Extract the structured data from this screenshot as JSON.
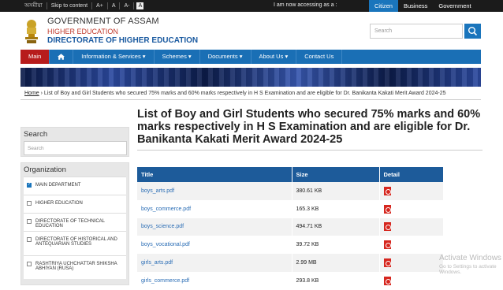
{
  "topbar": {
    "lang": "অসমীয়া",
    "skip": "Skip to content",
    "font_plus": "A+",
    "font_normal": "A",
    "font_minus": "A-",
    "contrast": "A",
    "accessing": "I am now accessing as a :",
    "tabs": [
      "Citizen",
      "Business",
      "Government"
    ]
  },
  "header": {
    "line1": "GOVERNMENT OF ASSAM",
    "line2": "HIGHER EDUCATION",
    "line3": "DIRECTORATE OF HIGHER EDUCATION",
    "search_placeholder": "Search"
  },
  "nav": {
    "items": [
      "Main",
      "Information & Services",
      "Schemes",
      "Documents",
      "About Us",
      "Contact Us"
    ]
  },
  "breadcrumb": {
    "home": "Home",
    "current": "List of Boy and Girl Students who secured 75% marks and 60% marks respectively in H S Examination and are eligible for Dr. Banikanta Kakati Merit Award 2024-25"
  },
  "sidebar": {
    "search_title": "Search",
    "search_placeholder": "Search",
    "org_title": "Organization",
    "org_items": [
      {
        "label": "MAIN DEPARTMENT",
        "checked": true
      },
      {
        "label": "HIGHER EDUCATION",
        "checked": false
      },
      {
        "label": "DIRECTORATE OF TECHNICAL EDUCATION",
        "checked": false
      },
      {
        "label": "DIRECTORATE OF HISTORICAL AND ANTEQUARIAN STUDIES",
        "checked": false
      },
      {
        "label": "RASHTRIYA UCHCHATTAR SHIKSHA ABHIYAN (RUSA)",
        "checked": false
      }
    ]
  },
  "main": {
    "title": "List of Boy and Girl Students who secured 75% marks and 60% marks respectively in H S Examination and are eligible for Dr. Banikanta Kakati Merit Award 2024-25",
    "columns": [
      "Title",
      "Size",
      "Detail"
    ],
    "rows": [
      {
        "title": "boys_arts.pdf",
        "size": "380.61 KB"
      },
      {
        "title": "boys_commerce.pdf",
        "size": "165.3 KB"
      },
      {
        "title": "boys_science.pdf",
        "size": "494.71 KB"
      },
      {
        "title": "boys_vocational.pdf",
        "size": "39.72 KB"
      },
      {
        "title": "girls_arts.pdf",
        "size": "2.99 MB"
      },
      {
        "title": "girls_commerce.pdf",
        "size": "293.8 KB"
      }
    ]
  },
  "watermark": {
    "line1": "Activate Windows",
    "line2": "Go to Settings to activate Windows."
  }
}
